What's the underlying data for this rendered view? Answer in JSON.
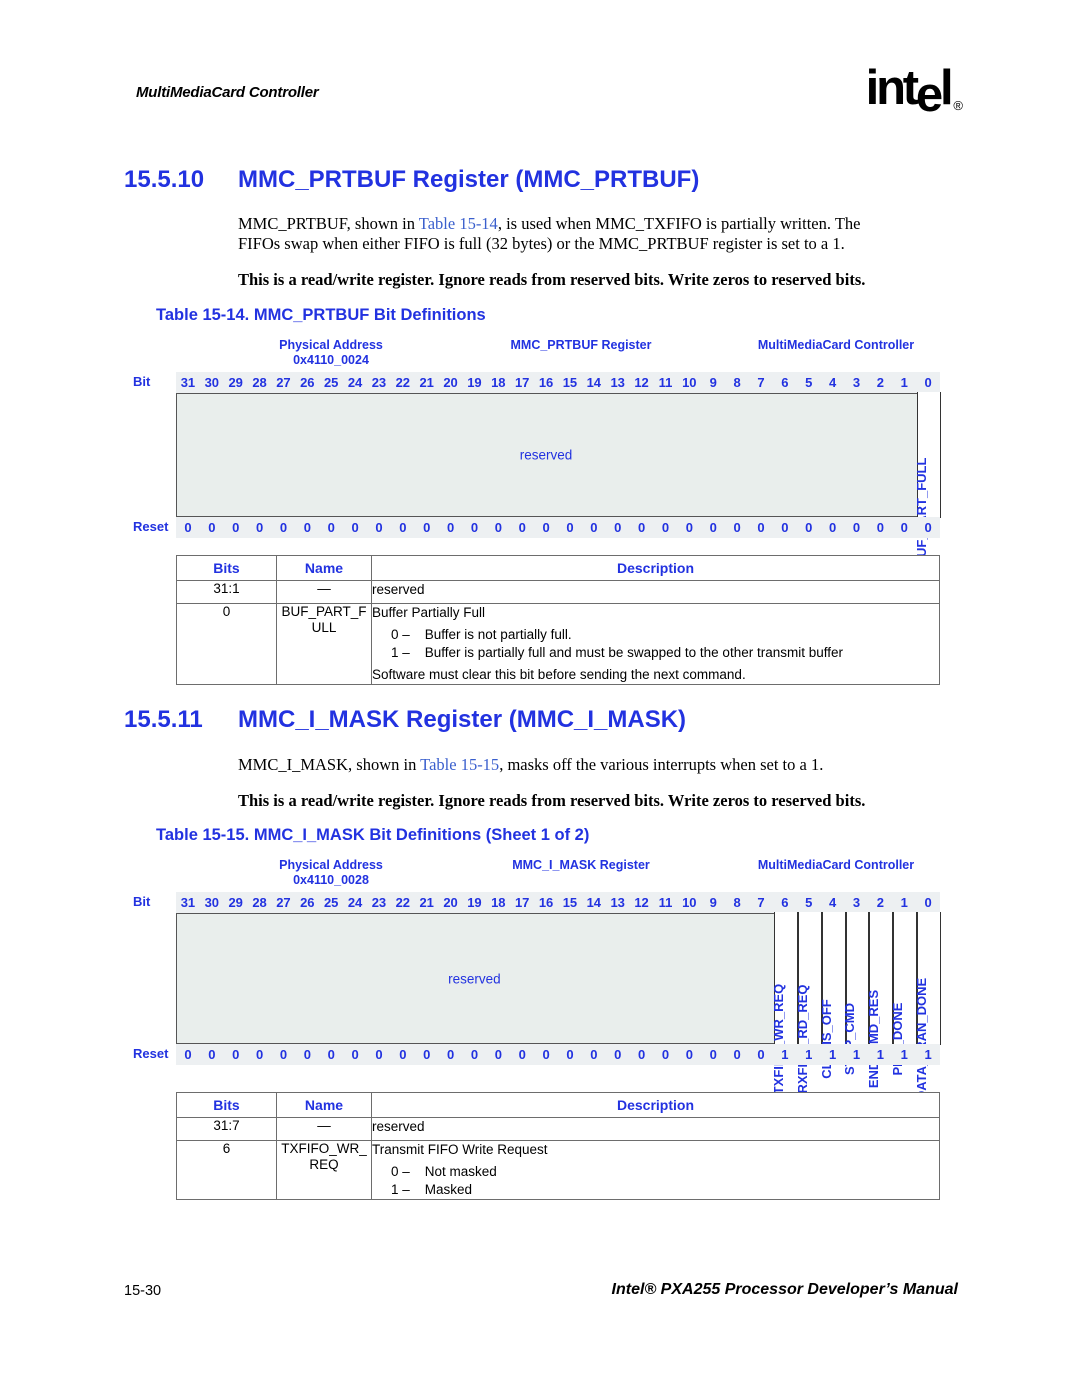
{
  "header": {
    "running_head": "MultiMediaCard Controller",
    "logo_text": "intel",
    "logo_registered": "®"
  },
  "sections": [
    {
      "number": "15.5.10",
      "title": "MMC_PRTBUF Register (MMC_PRTBUF)",
      "para1_a": "MMC_PRTBUF, shown in ",
      "para1_xref": "Table 15-14",
      "para1_b": ", is used when MMC_TXFIFO is partially written. The",
      "para1_line2": "FIFOs swap when either FIFO is full (32 bytes) or the MMC_PRTBUF register is set to a 1.",
      "para2": "This is a read/write register. Ignore reads from reserved bits. Write zeros to reserved bits.",
      "caption": "Table 15-14. MMC_PRTBUF Bit Definitions"
    },
    {
      "number": "15.5.11",
      "title": "MMC_I_MASK Register (MMC_I_MASK)",
      "para1_a": "MMC_I_MASK, shown in ",
      "para1_xref": "Table 15-15",
      "para1_b": ", masks off the various interrupts when set to a 1.",
      "para2": "This is a read/write register. Ignore reads from reserved bits. Write zeros to reserved bits.",
      "caption": "Table 15-15. MMC_I_MASK Bit Definitions (Sheet 1 of 2)"
    }
  ],
  "diagram1": {
    "physical_address_label": "Physical Address",
    "physical_address_value": "0x4110_0024",
    "register_label": "MMC_PRTBUF Register",
    "unit_label": "MultiMediaCard Controller",
    "bit_row_name": "Bit",
    "reset_row_name": "Reset",
    "bit_numbers": [
      "31",
      "30",
      "29",
      "28",
      "27",
      "26",
      "25",
      "24",
      "23",
      "22",
      "21",
      "20",
      "19",
      "18",
      "17",
      "16",
      "15",
      "14",
      "13",
      "12",
      "11",
      "10",
      "9",
      "8",
      "7",
      "6",
      "5",
      "4",
      "3",
      "2",
      "1",
      "0"
    ],
    "reset_values": [
      "0",
      "0",
      "0",
      "0",
      "0",
      "0",
      "0",
      "0",
      "0",
      "0",
      "0",
      "0",
      "0",
      "0",
      "0",
      "0",
      "0",
      "0",
      "0",
      "0",
      "0",
      "0",
      "0",
      "0",
      "0",
      "0",
      "0",
      "0",
      "0",
      "0",
      "0",
      "0"
    ],
    "reserved_label": "reserved",
    "fields": [
      {
        "name": "BUF_PART_FULL",
        "msb": 0,
        "lsb": 0
      }
    ]
  },
  "diagram2": {
    "physical_address_label": "Physical Address",
    "physical_address_value": "0x4110_0028",
    "register_label": "MMC_I_MASK Register",
    "unit_label": "MultiMediaCard Controller",
    "bit_row_name": "Bit",
    "reset_row_name": "Reset",
    "bit_numbers": [
      "31",
      "30",
      "29",
      "28",
      "27",
      "26",
      "25",
      "24",
      "23",
      "22",
      "21",
      "20",
      "19",
      "18",
      "17",
      "16",
      "15",
      "14",
      "13",
      "12",
      "11",
      "10",
      "9",
      "8",
      "7",
      "6",
      "5",
      "4",
      "3",
      "2",
      "1",
      "0"
    ],
    "reset_values": [
      "0",
      "0",
      "0",
      "0",
      "0",
      "0",
      "0",
      "0",
      "0",
      "0",
      "0",
      "0",
      "0",
      "0",
      "0",
      "0",
      "0",
      "0",
      "0",
      "0",
      "0",
      "0",
      "0",
      "0",
      "0",
      "1",
      "1",
      "1",
      "1",
      "1",
      "1",
      "1"
    ],
    "reserved_label": "reserved",
    "fields": [
      {
        "name": "TXFIFO_WR_REQ",
        "msb": 6,
        "lsb": 6
      },
      {
        "name": "RXFIFO_RD_REQ",
        "msb": 5,
        "lsb": 5
      },
      {
        "name": "CLK_IS_OFF",
        "msb": 4,
        "lsb": 4
      },
      {
        "name": "STOP_CMD",
        "msb": 3,
        "lsb": 3
      },
      {
        "name": "END_CMD_RES",
        "msb": 2,
        "lsb": 2
      },
      {
        "name": "PRG_DONE",
        "msb": 1,
        "lsb": 1
      },
      {
        "name": "DATA_TRAN_DONE",
        "msb": 0,
        "lsb": 0
      }
    ]
  },
  "table1": {
    "columns": [
      "Bits",
      "Name",
      "Description"
    ],
    "rows": [
      {
        "bits": "31:1",
        "name": "—",
        "desc_title": "reserved",
        "options": [],
        "note": ""
      },
      {
        "bits": "0",
        "name": "BUF_PART_F\nULL",
        "desc_title": "Buffer Partially Full",
        "options": [
          "0 –    Buffer is not partially full.",
          "1 –    Buffer is partially full and must be swapped to the other transmit buffer"
        ],
        "note": "Software must clear this bit before sending the next command."
      }
    ]
  },
  "table2": {
    "columns": [
      "Bits",
      "Name",
      "Description"
    ],
    "rows": [
      {
        "bits": "31:7",
        "name": "—",
        "desc_title": "reserved",
        "options": [],
        "note": ""
      },
      {
        "bits": "6",
        "name": "TXFIFO_WR_\nREQ",
        "desc_title": "Transmit FIFO Write Request",
        "options": [
          "0 –    Not masked",
          "1 –    Masked"
        ],
        "note": ""
      }
    ]
  },
  "footer": {
    "page_number": "15-30",
    "manual_title": "Intel® PXA255 Processor Developer’s Manual"
  },
  "colors": {
    "heading_blue": "#2232e0",
    "xref_blue": "#3a5fcd",
    "reg_fill": "#e9eeec",
    "bitrow_fill": "#edf0f2"
  }
}
